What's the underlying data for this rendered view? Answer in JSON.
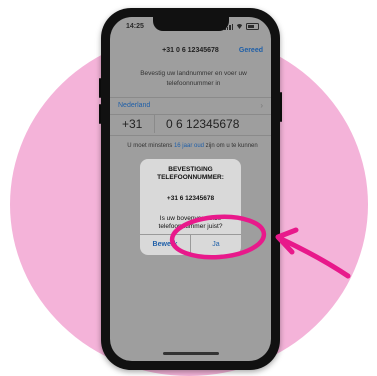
{
  "status_bar": {
    "time": "14:25"
  },
  "nav": {
    "title": "+31 0 6 12345678",
    "done_label": "Gereed"
  },
  "instructions": "Bevestig uw landnummer en voer uw telefoonnummer in",
  "country": {
    "name": "Nederland"
  },
  "phone": {
    "code": "+31",
    "number": "0 6 12345678"
  },
  "age_notice": {
    "prefix": "U moet minstens ",
    "link": "16 jaar oud",
    "suffix": " zijn om u te kunnen"
  },
  "alert": {
    "title": "BEVESTIGING TELEFOONNUMMER:",
    "number": "+31 6 12345678",
    "question": "Is uw bovenvermelde telefoonnummer juist?",
    "edit_label": "Bewerk",
    "confirm_label": "Ja"
  },
  "colors": {
    "circle": "#f4b3d9",
    "annotation": "#e8198b",
    "link": "#1f5fa8"
  }
}
